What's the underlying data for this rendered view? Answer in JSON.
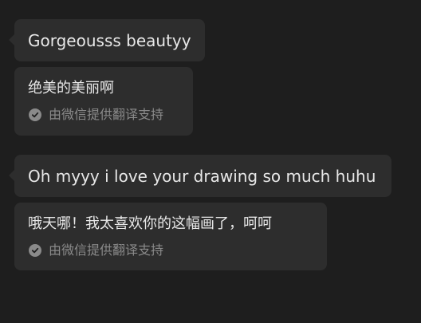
{
  "messages": [
    {
      "text": "Gorgeousss beautyy",
      "translation": "绝美的美丽啊",
      "translation_note": "由微信提供翻译支持"
    },
    {
      "text": "Oh myyy i love your drawing so much huhu",
      "translation": "哦天哪！我太喜欢你的这幅画了，呵呵",
      "translation_note": "由微信提供翻译支持"
    }
  ],
  "colors": {
    "background": "#1e1e1e",
    "bubble": "#2d2d2d",
    "text": "#e8e8e8",
    "muted": "#8a8a8a"
  },
  "icons": {
    "translation_verified": "check-circle-icon"
  }
}
